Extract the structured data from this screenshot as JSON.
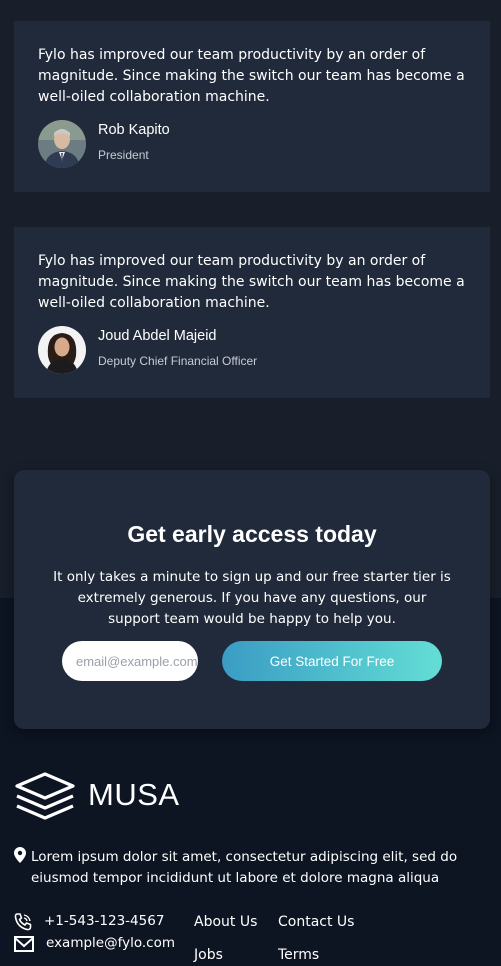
{
  "testimonials": [
    {
      "quote": "Fylo has improved our team productivity by an order of magnitude. Since making the switch our team has become a well-oiled collaboration machine.",
      "name": "Rob Kapito",
      "role": "President"
    },
    {
      "quote": "Fylo has improved our team productivity by an order of magnitude. Since making the switch our team has become a well-oiled collaboration machine.",
      "name": "Joud Abdel Majeid",
      "role": "Deputy Chief Financial Officer"
    }
  ],
  "cta": {
    "title": "Get early access today",
    "text": "It only takes a minute to sign up and our free starter tier is extremely generous. If you have any questions, our support team would be happy to help you.",
    "email_placeholder": "email@example.com",
    "button_label": "Get Started For Free"
  },
  "footer": {
    "brand": "MUSA",
    "address": "Lorem ipsum dolor sit amet, consectetur adipiscing elit, sed do eiusmod tempor incididunt ut labore et dolore magna aliqua",
    "phone": "+1-543-123-4567",
    "email": "example@fylo.com",
    "links": {
      "about": "About Us",
      "contact": "Contact Us",
      "jobs": "Jobs",
      "terms": "Terms"
    }
  },
  "colors": {
    "page_bg": "#181f2a",
    "card_bg": "#212a3a",
    "footer_bg": "#0d1422",
    "gradient_start": "#3a9cc4",
    "gradient_end": "#63ded5"
  }
}
